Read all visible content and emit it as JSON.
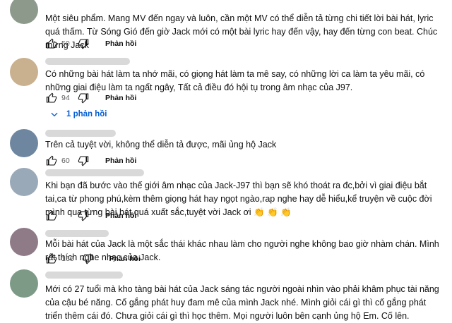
{
  "comments": [
    {
      "text": "Một siêu phẩm. Mang MV đến ngay và luôn, cần một MV có thể diễn tả từng chi tiết lời bài hát, lyric quá thấm. Từ Sóng Gió đến giờ Jack mới có một bài lyric hay đến vậy, hay đến từng con beat. Chúc mừng Jack",
      "likes": "50",
      "reply_label": "Phản hồi"
    },
    {
      "text": "Có những bài hát làm ta nhớ mãi, có giọng hát làm ta mê say, có những lời ca làm ta yêu mãi, có những giai điệu làm ta ngất ngây, Tất cả điều đó hội tụ trong âm nhạc của J97.",
      "likes": "94",
      "reply_label": "Phản hồi",
      "replies_toggle": "1 phản hồi"
    },
    {
      "text": "Trên cả tuyệt vời, không thể diễn tả được, mãi ủng hộ Jack",
      "likes": "60",
      "reply_label": "Phản hồi"
    },
    {
      "text": "Khi bạn đã bước vào thế giới âm nhạc của Jack-J97 thì bạn sẽ khó thoát ra đc,bởi vì giai điệu bắt tai,ca từ phong phú,kèm thêm giọng hát hay ngọt ngào,rap nghe hay dễ hiểu,kể truyện về cuộc đời mình qua từng bài hát,quá xuất sắc,tuyệt vời Jack ơi 👏 👏 👏",
      "likes": "",
      "reply_label": "Phản hồi"
    },
    {
      "text": "Mỗi bài hát của Jack là một sắc thái khác nhau làm cho người nghe không bao giờ nhàm chán. Mình rất thích nghe nhạc của Jack.",
      "likes": "166",
      "reply_label": "Phản hồi"
    },
    {
      "text": "Mới có 27 tuổi mà kho tàng bài hát của Jack sáng tác người ngoài nhìn vào phải khâm phục tài năng của cậu bé năng. Cố gắng phát huy đam mê của mình Jack nhé. Mình giỏi cái gì thì cố gắng phát triển thêm cái đó. Chưa giỏi cái gì thì học thêm. Mọi người luôn bên cạnh ủng hộ Em. Cố lên.",
      "likes": "",
      "reply_label": "Phản hồi"
    }
  ],
  "icons": {
    "like": "thumb-up-icon",
    "dislike": "thumb-down-icon",
    "expand": "chevron-down-icon"
  },
  "colors": {
    "link_blue": "#065fd4",
    "meta_gray": "#606060"
  }
}
